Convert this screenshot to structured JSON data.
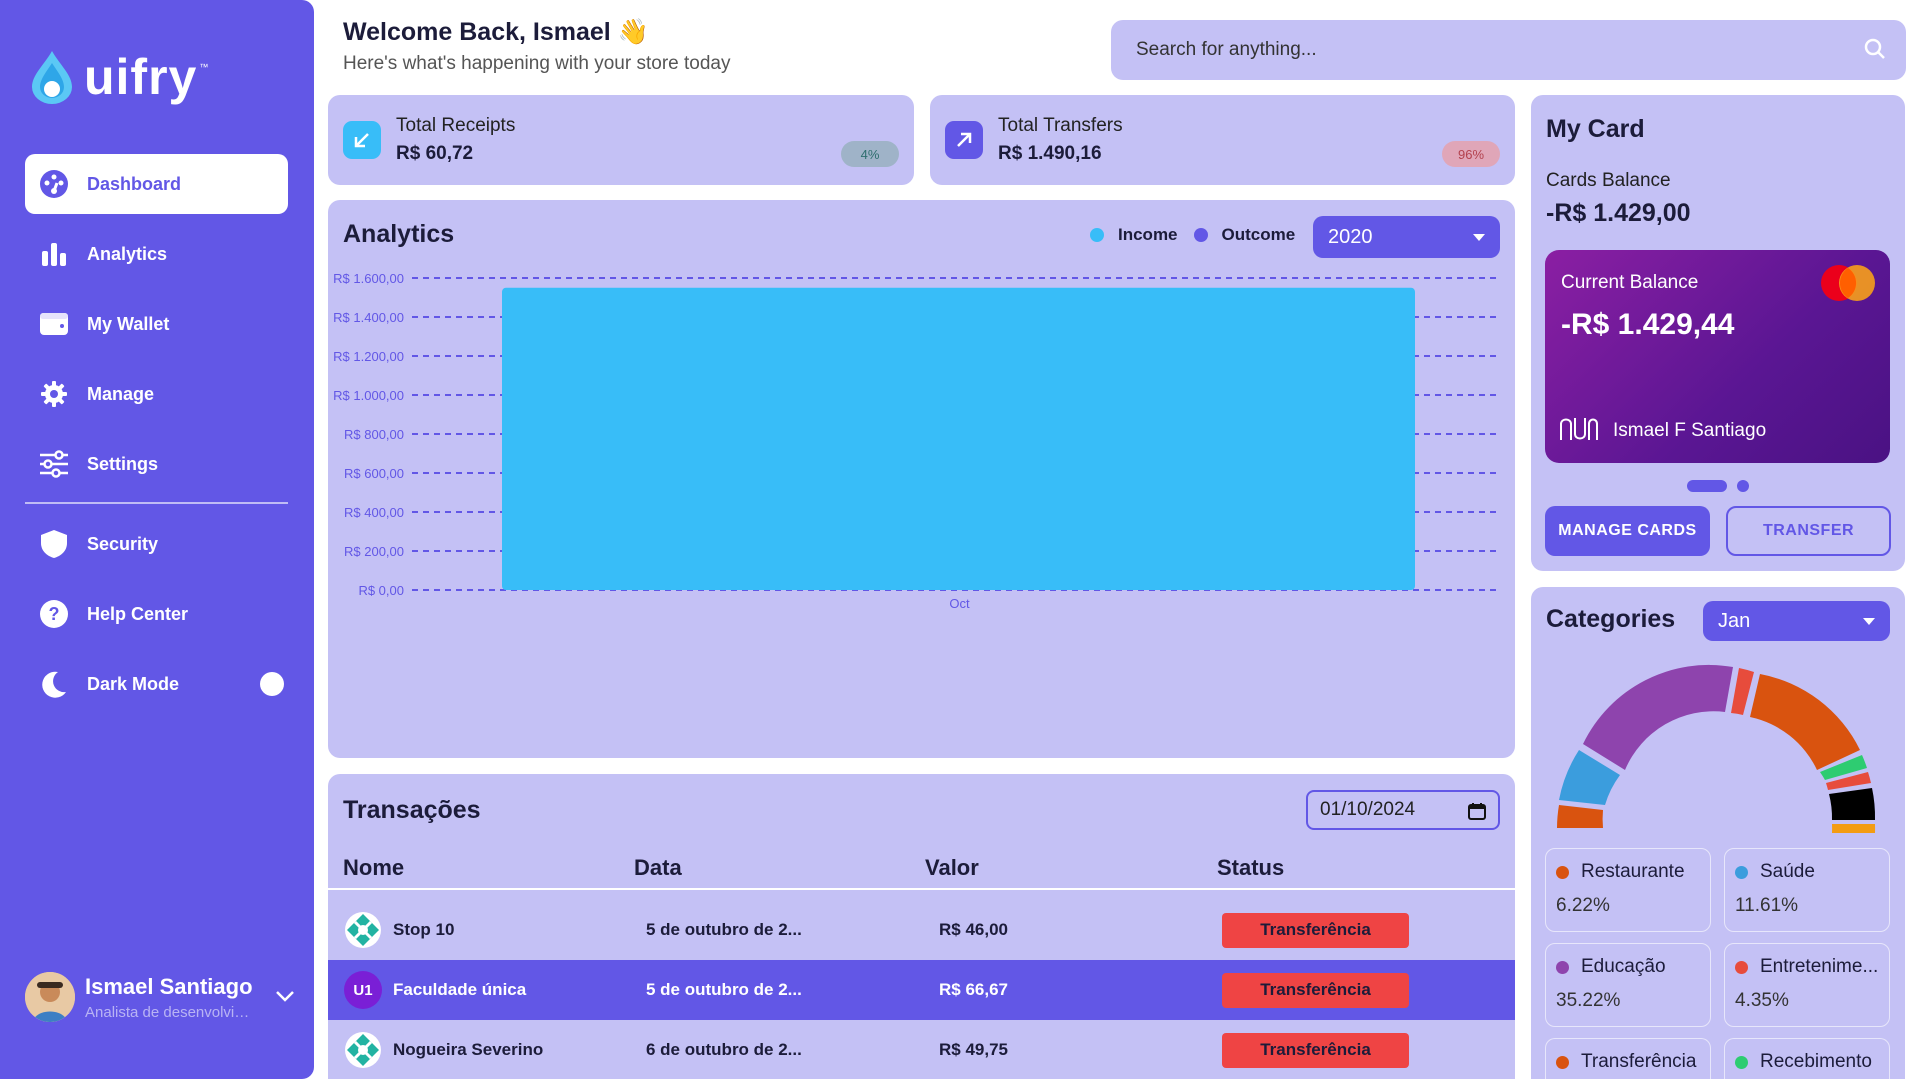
{
  "brand": {
    "name": "uifry",
    "tm": "™"
  },
  "sidebar": {
    "items": [
      {
        "label": "Dashboard",
        "icon": "dashboard-icon",
        "active": true
      },
      {
        "label": "Analytics",
        "icon": "bar-chart-icon"
      },
      {
        "label": "My Wallet",
        "icon": "wallet-icon"
      },
      {
        "label": "Manage",
        "icon": "gear-icon"
      },
      {
        "label": "Settings",
        "icon": "sliders-icon"
      },
      {
        "label": "Security",
        "icon": "shield-icon"
      },
      {
        "label": "Help Center",
        "icon": "help-icon"
      },
      {
        "label": "Dark Mode",
        "icon": "moon-icon"
      }
    ]
  },
  "profile": {
    "name": "Ismael Santiago",
    "role": "Analista de desenvolvimento"
  },
  "header": {
    "title": "Welcome Back, Ismael",
    "wave": "👋",
    "subtitle": "Here's what's happening with your store today"
  },
  "search": {
    "placeholder": "Search for anything..."
  },
  "stats": [
    {
      "label": "Total Receipts",
      "value": "R$ 60,72",
      "badge": "4%",
      "badge_color": "#9fb3c8",
      "icon_bg": "#38bdf8"
    },
    {
      "label": "Total Transfers",
      "value": "R$ 1.490,16",
      "badge": "96%",
      "badge_color": "#e0a6b8",
      "icon_bg": "#6257e6"
    }
  ],
  "analytics": {
    "title": "Analytics",
    "legend": [
      {
        "name": "Income",
        "color": "#38bdf8"
      },
      {
        "name": "Outcome",
        "color": "#6257e6"
      }
    ],
    "year": "2020"
  },
  "chart_data": {
    "type": "bar",
    "categories": [
      "Oct"
    ],
    "series": [
      {
        "name": "Income",
        "values": [
          1550
        ]
      }
    ],
    "yticks": [
      "R$ 0,00",
      "R$ 200,00",
      "R$ 400,00",
      "R$ 600,00",
      "R$ 800,00",
      "R$ 1.000,00",
      "R$ 1.200,00",
      "R$ 1.400,00",
      "R$ 1.600,00"
    ],
    "ylim": [
      0,
      1600
    ],
    "grid": true,
    "legend": "top-right"
  },
  "transactions": {
    "title": "Transações",
    "date": "01/10/2024",
    "columns": [
      "Nome",
      "Data",
      "Valor",
      "Status"
    ],
    "rows": [
      {
        "name": "Stop 10",
        "date": "5 de outubro de 2...",
        "value": "R$ 46,00",
        "status": "Transferência",
        "icon": "stop10-logo"
      },
      {
        "name": "Faculdade única",
        "date": "5 de outubro de 2...",
        "value": "R$ 66,67",
        "status": "Transferência",
        "icon": "u1-logo",
        "icon_text": "U1",
        "selected": true
      },
      {
        "name": "Nogueira Severino",
        "date": "6 de outubro de 2...",
        "value": "R$ 49,75",
        "status": "Transferência",
        "icon": "nogueira-logo"
      }
    ]
  },
  "mycard": {
    "title": "My Card",
    "balance_label": "Cards Balance",
    "balance": "-R$ 1.429,00",
    "card": {
      "label": "Current Balance",
      "value": "-R$ 1.429,44",
      "holder": "Ismael F Santiago",
      "brand": "mastercard-logo",
      "bank": "nubank-logo"
    },
    "manage_label": "MANAGE CARDS",
    "transfer_label": "TRANSFER"
  },
  "categories": {
    "title": "Categories",
    "month": "Jan",
    "items": [
      {
        "name": "Restaurante",
        "pct": "6.22%",
        "color": "#d9530f"
      },
      {
        "name": "Saúde",
        "pct": "11.61%",
        "color": "#3b9ddd"
      },
      {
        "name": "Educação",
        "pct": "35.22%",
        "color": "#8e44ad"
      },
      {
        "name": "Entretenime...",
        "pct": "4.35%",
        "color": "#e74c3c"
      },
      {
        "name": "Transferência",
        "pct": "",
        "color": "#d9530f"
      },
      {
        "name": "Recebimento",
        "pct": "",
        "color": "#2ecc71"
      }
    ]
  }
}
